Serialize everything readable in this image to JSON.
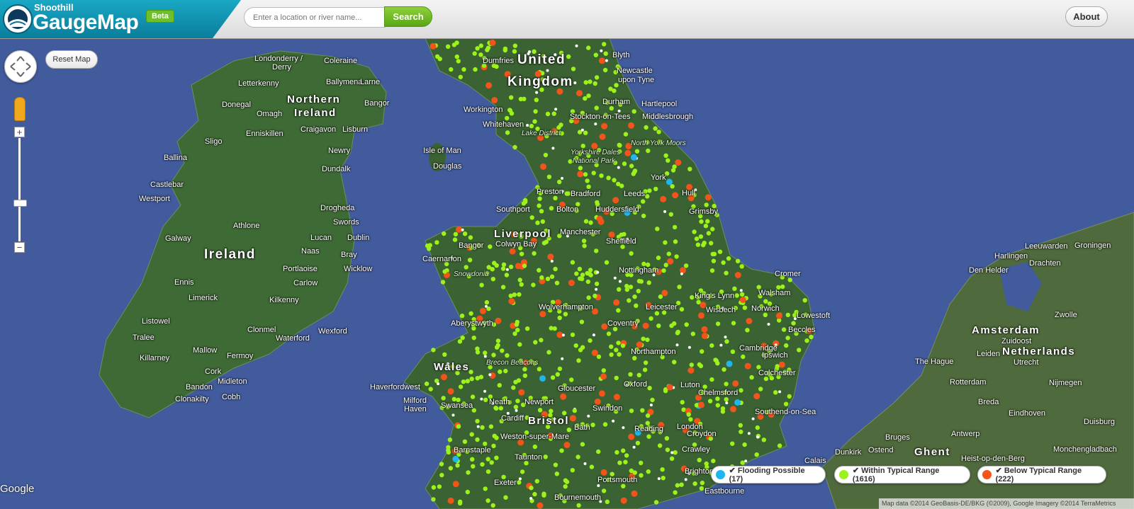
{
  "header": {
    "brand_top": "Shoothill",
    "brand_main": "GaugeMap",
    "beta_badge": "Beta",
    "search_placeholder": "Enter a location or river name...",
    "search_label": "Search",
    "about_label": "About"
  },
  "map_controls": {
    "reset_label": "Reset Map",
    "zoom_in": "+",
    "zoom_out": "−"
  },
  "map_labels": {
    "united_kingdom_1": "United",
    "united_kingdom_2": "Kingdom",
    "northern_ireland_1": "Northern",
    "northern_ireland_2": "Ireland",
    "ireland": "Ireland",
    "wales": "Wales",
    "netherlands": "Netherlands",
    "isle_of_man": "Isle of Man",
    "douglas": "Douglas",
    "londonderry": "Londonderry /",
    "derry": "Derry",
    "coleraine": "Coleraine",
    "letterkenny": "Letterkenny",
    "ballymena": "Ballymena",
    "larne": "Larne",
    "donegal": "Donegal",
    "omagh": "Omagh",
    "bangor_ni": "Bangor",
    "enniskillen": "Enniskillen",
    "craigavon": "Craigavon",
    "lisburn": "Lisburn",
    "sligo": "Sligo",
    "newry": "Newry",
    "ballina": "Ballina",
    "dundalk": "Dundalk",
    "castlebar": "Castlebar",
    "westport": "Westport",
    "drogheda": "Drogheda",
    "athlone": "Athlone",
    "swords": "Swords",
    "galway": "Galway",
    "lucan": "Lucan",
    "dublin": "Dublin",
    "naas": "Naas",
    "bray": "Bray",
    "portlaoise": "Portlaoise",
    "wicklow": "Wicklow",
    "ennis": "Ennis",
    "carlow": "Carlow",
    "limerick": "Limerick",
    "kilkenny": "Kilkenny",
    "listowel": "Listowel",
    "tralee": "Tralee",
    "clonmel": "Clonmel",
    "wexford": "Wexford",
    "waterford": "Waterford",
    "mallow": "Mallow",
    "killarney": "Killarney",
    "fermoy": "Fermoy",
    "cork": "Cork",
    "midleton": "Midleton",
    "bandon": "Bandon",
    "clonakilty": "Clonakilty",
    "cobh": "Cobh",
    "dumfries": "Dumfries",
    "blyth": "Blyth",
    "newcastle": "Newcastle",
    "upon_tyne": "upon Tyne",
    "workington": "Workington",
    "durham": "Durham",
    "hartlepool": "Hartlepool",
    "stockton": "Stockton-on-Tees",
    "middlesbrough": "Middlesbrough",
    "whitehaven": "Whitehaven",
    "lake_district": "Lake District",
    "yorkshire_dales": "Yorkshire Dales",
    "national_park": "National Park",
    "north_york_moors": "North York Moors",
    "york": "York",
    "preston": "Preston",
    "bradford": "Bradford",
    "leeds": "Leeds",
    "hull": "Hull",
    "southport": "Southport",
    "bolton": "Bolton",
    "huddersfield": "Huddersfield",
    "grimsby": "Grimsby",
    "liverpool": "Liverpool",
    "manchester": "Manchester",
    "sheffield": "Sheffield",
    "bangor_wales": "Bangor",
    "colwyn_bay": "Colwyn Bay",
    "caernarfon": "Caernarfon",
    "snowdonia": "Snowdonia",
    "nottingham": "Nottingham",
    "cromer": "Cromer",
    "walsham": "Walsham",
    "kings_lynn": "King's Lynn",
    "wisbech": "Wisbech",
    "norwich": "Norwich",
    "lowestoft": "Lowestoft",
    "beccles": "Beccles",
    "wolverhampton": "Wolverhampton",
    "leicester": "Leicester",
    "aberystwyth": "Aberystwyth",
    "coventry": "Coventry",
    "northampton": "Northampton",
    "cambridge": "Cambridge",
    "ipswich": "Ipswich",
    "colchester": "Colchester",
    "brecon_beacons": "Brecon Beacons",
    "haverfordwest": "Haverfordwest",
    "gloucester": "Gloucester",
    "oxford": "Oxford",
    "luton": "Luton",
    "chelmsford": "Chelmsford",
    "milford_1": "Milford",
    "milford_2": "Haven",
    "swansea": "Swansea",
    "neath": "Neath",
    "newport": "Newport",
    "swindon": "Swindon",
    "southend": "Southend-on-Sea",
    "cardiff": "Cardiff",
    "bristol": "Bristol",
    "bath": "Bath",
    "reading": "Reading",
    "london": "London",
    "weston": "Weston-super-Mare",
    "croydon": "Croydon",
    "barnstaple": "Barnstaple",
    "taunton": "Taunton",
    "crawley": "Crawley",
    "calais": "Calais",
    "dunkirk": "Dunkirk",
    "ostend": "Ostend",
    "bruges": "Bruges",
    "ghent": "Ghent",
    "antwerp": "Antwerp",
    "exeter": "Exeter",
    "portsmouth": "Portsmouth",
    "brighton": "Brighton",
    "eastbourne": "Eastbourne",
    "bournemouth": "Bournemouth",
    "leeuwarden": "Leeuwarden",
    "groningen": "Groningen",
    "harlingen": "Harlingen",
    "den_helder": "Den Helder",
    "drachten": "Drachten",
    "zwolle": "Zwolle",
    "amsterdam": "Amsterdam",
    "zuidoost": "Zuidoost",
    "the_hague": "The Hague",
    "leiden": "Leiden",
    "utrecht": "Utrecht",
    "rotterdam": "Rotterdam",
    "nijmegen": "Nijmegen",
    "breda": "Breda",
    "eindhoven": "Eindhoven",
    "duisburg": "Duisburg",
    "monchengladbach": "Monchengladbach",
    "heist": "Heist-op-den-Berg"
  },
  "legend": {
    "flooding_label": "✔ Flooding Possible (17)",
    "typical_label": "✔ Within Typical Range (1616)",
    "below_label": "✔ Below Typical Range (222)"
  },
  "colors": {
    "flooding": "#1fb6ee",
    "typical": "#9cf21a",
    "below": "#f2541b",
    "unknown": "#ffffff"
  },
  "footer": {
    "google": "Google",
    "attribution": "Map data ©2014 GeoBasis-DE/BKG (©2009), Google Imagery ©2014 TerraMetrics"
  }
}
